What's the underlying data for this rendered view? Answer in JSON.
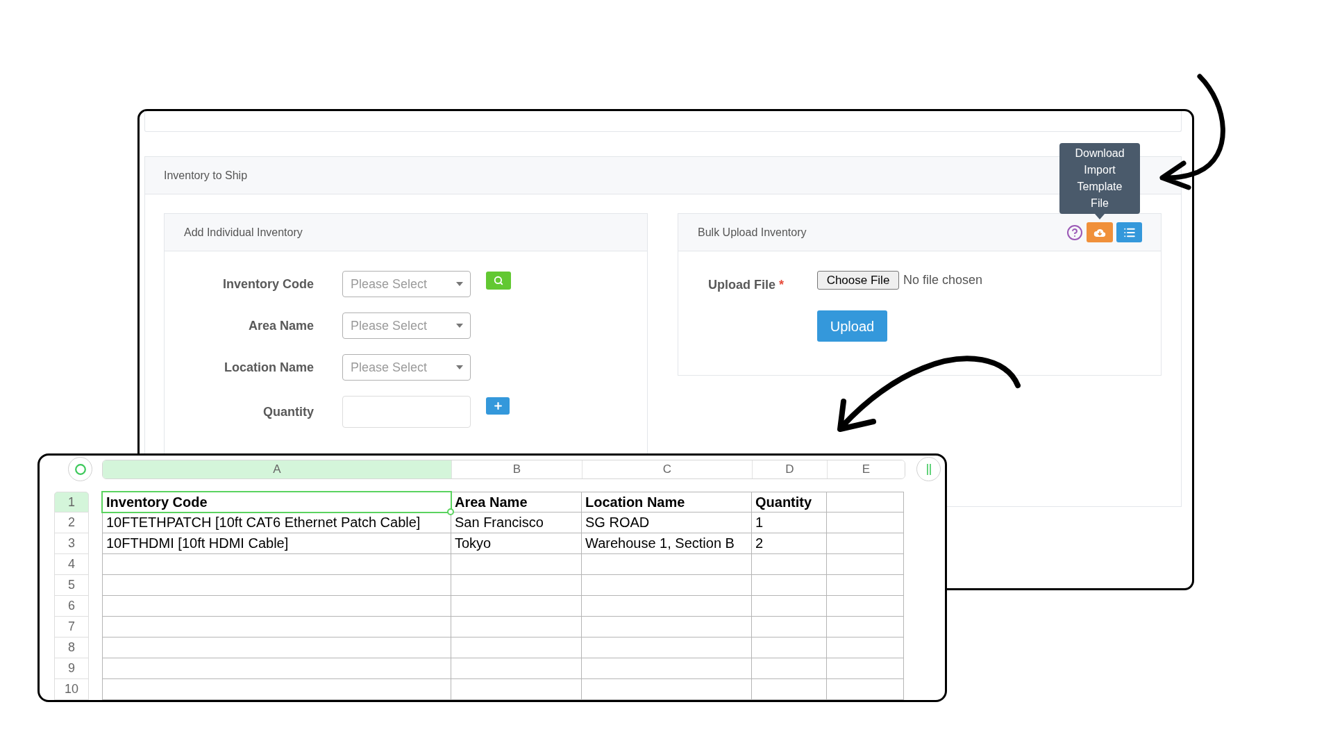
{
  "inventory_to_ship": {
    "title": "Inventory to Ship",
    "add_individual_inventory": {
      "title": "Add Individual Inventory",
      "fields": [
        {
          "kind": "select",
          "label": "Inventory Code",
          "placeholder": "Please Select",
          "button": {
            "kind": "search"
          }
        },
        {
          "kind": "select",
          "label": "Area Name",
          "placeholder": "Please Select"
        },
        {
          "kind": "select",
          "label": "Location Name",
          "placeholder": "Please Select"
        },
        {
          "kind": "input",
          "label": "Quantity",
          "button": {
            "kind": "add"
          }
        }
      ]
    },
    "bulk_upload_inventory": {
      "title": "Bulk Upload Inventory",
      "tooltip": "Download Import Template File",
      "upload_file": {
        "label": "Upload File",
        "required_mark": "*",
        "button": "Choose File",
        "status": "No file chosen"
      },
      "upload_button": "Upload"
    }
  },
  "spreadsheet": {
    "columns": [
      {
        "label": "A",
        "selected": true
      },
      {
        "label": "B",
        "selected": false
      },
      {
        "label": "C",
        "selected": false
      },
      {
        "label": "D",
        "selected": false
      },
      {
        "label": "E",
        "selected": false
      }
    ],
    "header_row": {
      "label": "1",
      "selected": true,
      "cells": [
        "Inventory Code",
        "Area Name",
        "Location Name",
        "Quantity"
      ]
    },
    "rows": [
      {
        "label": "2",
        "selected": false,
        "cells": [
          "10FTETHPATCH [10ft CAT6 Ethernet Patch Cable]",
          "San Francisco",
          "SG ROAD",
          "1"
        ]
      },
      {
        "label": "3",
        "selected": false,
        "cells": [
          "10FTHDMI [10ft HDMI Cable]",
          "Tokyo",
          "Warehouse 1, Section B",
          "2"
        ]
      },
      {
        "label": "4",
        "selected": false
      },
      {
        "label": "5",
        "selected": false
      },
      {
        "label": "6",
        "selected": false
      },
      {
        "label": "7",
        "selected": false
      },
      {
        "label": "8",
        "selected": false
      },
      {
        "label": "9",
        "selected": false
      },
      {
        "label": "10",
        "selected": false
      }
    ]
  }
}
